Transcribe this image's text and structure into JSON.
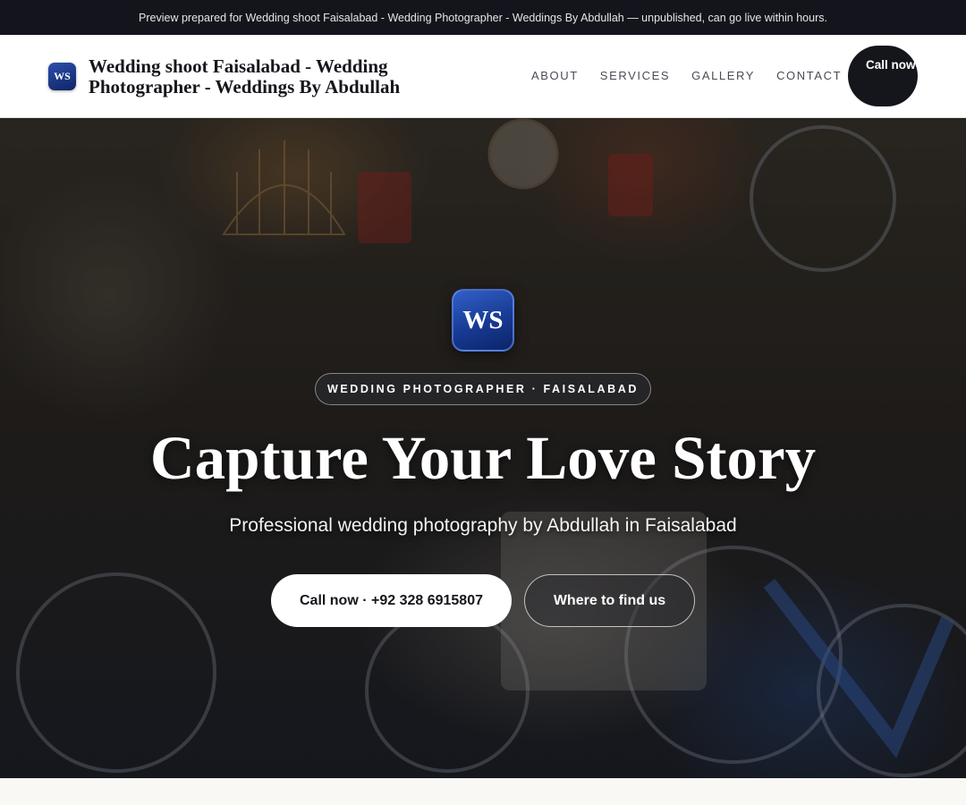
{
  "preview_bar": {
    "text": "Preview prepared for Wedding shoot Faisalabad - Wedding Photographer - Weddings By Abdullah — unpublished, can go live within hours."
  },
  "header": {
    "logo_text": "WS",
    "brand_name": "Wedding shoot Faisalabad - Wedding Photographer - Weddings By Abdullah",
    "nav": [
      {
        "label": "About"
      },
      {
        "label": "Services"
      },
      {
        "label": "Gallery"
      },
      {
        "label": "Contact"
      }
    ],
    "call_button": "Call now"
  },
  "hero": {
    "logo_text": "WS",
    "eyebrow": "WEDDING PHOTOGRAPHER · FAISALABAD",
    "title": "Capture Your Love Story",
    "subtitle": "Professional wedding photography by Abdullah in Faisalabad",
    "primary_button": "Call now · +92 328 6915807",
    "secondary_button": "Where to find us"
  },
  "colors": {
    "preview_bar_bg": "#14151c",
    "dark_button": "#15161c",
    "logo_blue": "#173a93"
  }
}
